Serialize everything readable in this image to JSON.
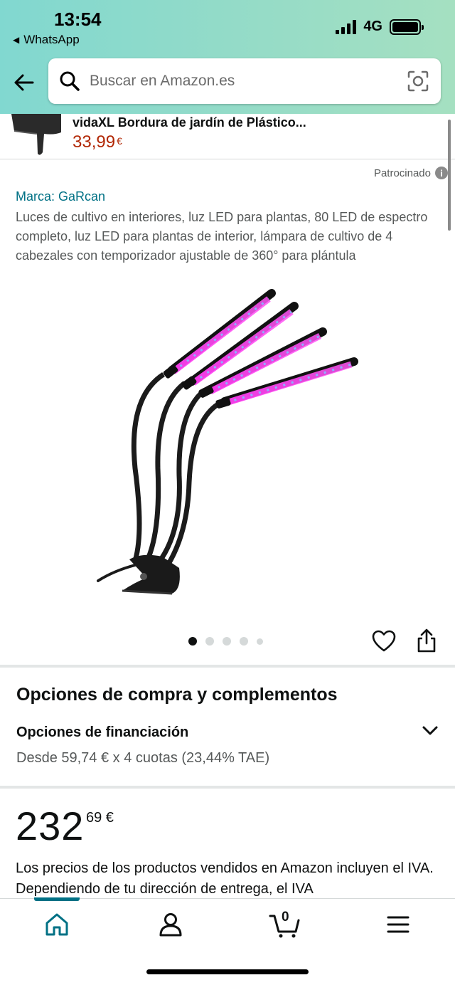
{
  "status_bar": {
    "time": "13:54",
    "back_app": "WhatsApp",
    "network": "4G"
  },
  "search": {
    "placeholder": "Buscar en Amazon.es"
  },
  "sponsored_strip": {
    "title": "vidaXL Bordura de jardín de Plástico...",
    "price": "33,99",
    "currency": "€"
  },
  "product": {
    "sponsored_label": "Patrocinado",
    "brand": "Marca: GaRcan",
    "title": "Luces de cultivo en interiores, luz LED para plantas, 80 LED de espectro completo, luz LED para plantas de interior, lámpara de cultivo de 4 cabezales con temporizador ajustable de 360° para plántula",
    "image_count": 5,
    "active_image": 1
  },
  "purchase": {
    "heading": "Opciones de compra y complementos",
    "financing_title": "Opciones de financiación",
    "financing_detail": "Desde 59,74 € x 4 cuotas (23,44% TAE)"
  },
  "price": {
    "whole": "232",
    "fraction": "69 €",
    "tax_note": "Los precios de los productos vendidos en Amazon incluyen el IVA. Dependiendo de tu dirección de entrega, el IVA"
  },
  "bottom_nav": {
    "cart_count": "0",
    "items": [
      "home-icon",
      "account-icon",
      "cart-icon",
      "menu-icon"
    ]
  },
  "colors": {
    "accent": "#007185",
    "price_red": "#b12704",
    "header_gradient_start": "#81d8d0",
    "header_gradient_end": "#a5e0c1"
  }
}
